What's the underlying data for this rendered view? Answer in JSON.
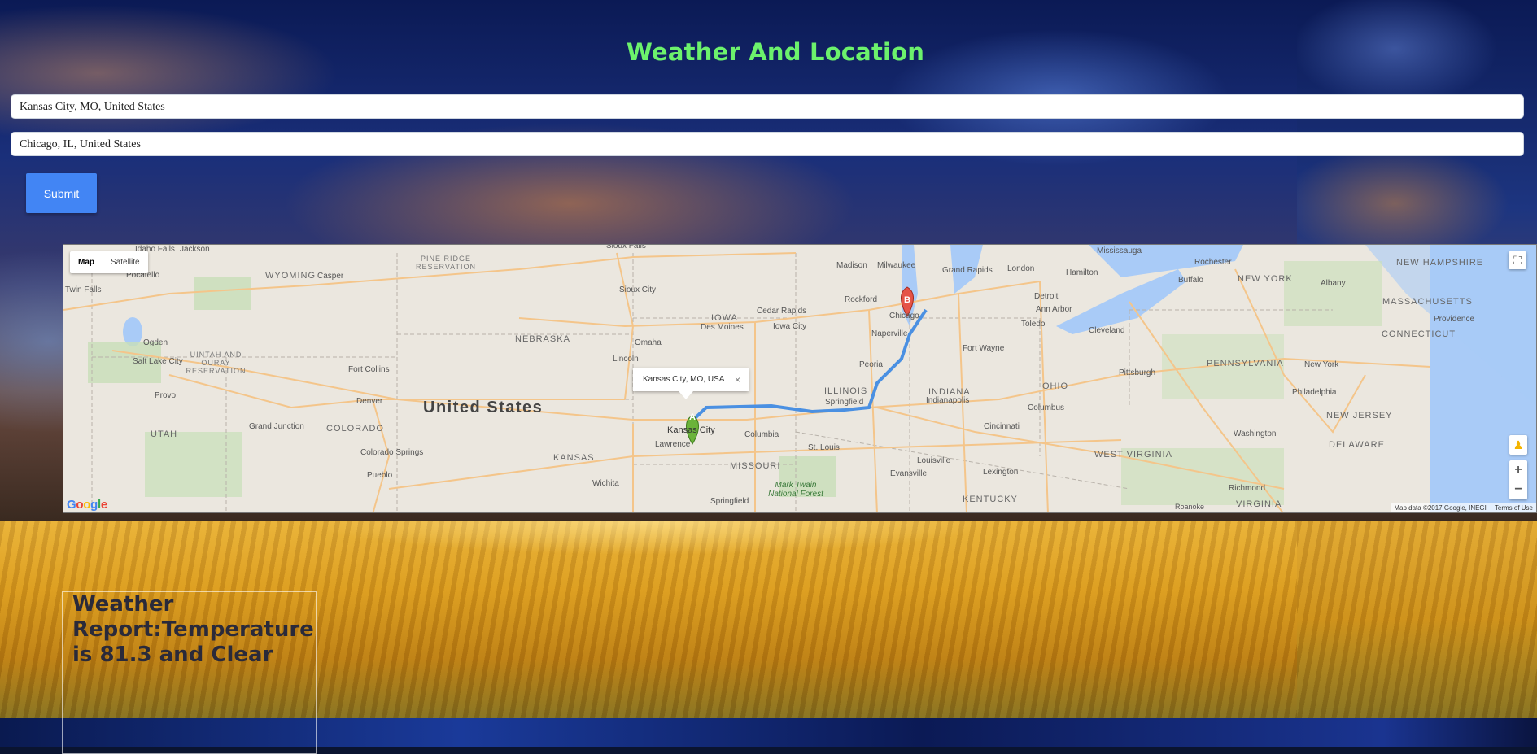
{
  "page": {
    "title": "Weather And Location"
  },
  "form": {
    "origin_value": "Kansas City, MO, United States",
    "destination_value": "Chicago, IL, United States",
    "submit_label": "Submit"
  },
  "map": {
    "type_controls": {
      "map": "Map",
      "satellite": "Satellite"
    },
    "popup": {
      "text": "Kansas City, MO, USA",
      "close": "×"
    },
    "markers": {
      "a": "A",
      "b": "B"
    },
    "country_label": "United States",
    "states": [
      "WYOMING",
      "NEBRASKA",
      "IOWA",
      "COLORADO",
      "UTAH",
      "KANSAS",
      "MISSOURI",
      "ILLINOIS",
      "INDIANA",
      "OHIO",
      "PENNSYLVANIA",
      "NEW YORK",
      "WEST VIRGINIA",
      "KENTUCKY",
      "VIRGINIA",
      "NEW JERSEY",
      "DELAWARE",
      "NEW HAMPSHIRE",
      "MASSACHUSETTS",
      "CONNECTICUT"
    ],
    "cities": [
      "Idaho Falls",
      "Jackson",
      "Pocatello",
      "Twin Falls",
      "Casper",
      "Sioux Falls",
      "Madison",
      "Milwaukee",
      "Grand Rapids",
      "Mississauga",
      "Rochester",
      "London",
      "Hamilton",
      "Buffalo",
      "Albany",
      "Sioux City",
      "Cedar Rapids",
      "Rockford",
      "Chicago",
      "Detroit",
      "Toledo",
      "Ann Arbor",
      "Des Moines",
      "Iowa City",
      "Naperville",
      "Cleveland",
      "Providence",
      "Ogden",
      "Omaha",
      "Fort Wayne",
      "Salt Lake City",
      "Lincoln",
      "Peoria",
      "Pittsburgh",
      "New York",
      "Fort Collins",
      "Provo",
      "Denver",
      "Springfield",
      "Indianapolis",
      "Columbus",
      "Philadelphia",
      "Grand Junction",
      "Kansas City",
      "Columbia",
      "Cincinnati",
      "Lawrence",
      "St. Louis",
      "Washington",
      "Colorado Springs",
      "Louisville",
      "Pueblo",
      "Lexington",
      "Evansville",
      "Wichita",
      "Richmond",
      "Springfield",
      "Roanoke"
    ],
    "parks": [
      "PINE RIDGE RESERVATION",
      "UINTAH AND OURAY RESERVATION",
      "Mark Twain National Forest"
    ],
    "attribution": "Map data ©2017 Google, INEGI",
    "terms": "Terms of Use",
    "logo": [
      "G",
      "o",
      "o",
      "g",
      "l",
      "e"
    ],
    "zoom_in": "+",
    "zoom_out": "−"
  },
  "report": {
    "text": "Weather Report:Temperature is 81.3 and Clear"
  },
  "colors": {
    "title": "#6cf26c",
    "submit": "#4285f4",
    "route": "#4a90e2"
  }
}
